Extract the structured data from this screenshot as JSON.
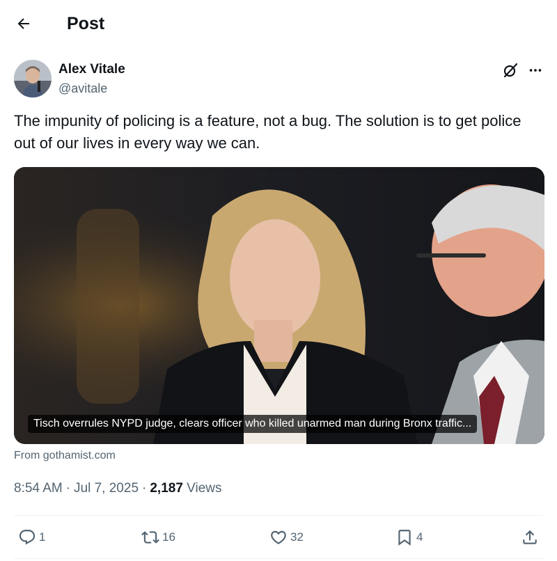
{
  "header": {
    "title": "Post"
  },
  "author": {
    "name": "Alex Vitale",
    "handle": "@avitale"
  },
  "tweet": {
    "text": "The impunity of policing is a feature, not a bug. The solution is to get police out of our lives in every way we can."
  },
  "card": {
    "caption": "Tisch overrules NYPD judge, clears officer who killed unarmed man during Bronx traffic...",
    "source": "From gothamist.com"
  },
  "meta": {
    "time": "8:54 AM",
    "date": "Jul 7, 2025",
    "views_count": "2,187",
    "views_label": "Views"
  },
  "actions": {
    "replies": "1",
    "reposts": "16",
    "likes": "32",
    "bookmarks": "4"
  },
  "icons": {
    "back": "arrow-left-icon",
    "grok": "grok-icon",
    "more": "more-dots-icon",
    "reply": "reply-icon",
    "repost": "repost-icon",
    "like": "heart-icon",
    "bookmark": "bookmark-icon",
    "share": "share-icon"
  },
  "colors": {
    "text": "#0f1419",
    "secondary": "#536471",
    "divider": "#eff3f4"
  }
}
